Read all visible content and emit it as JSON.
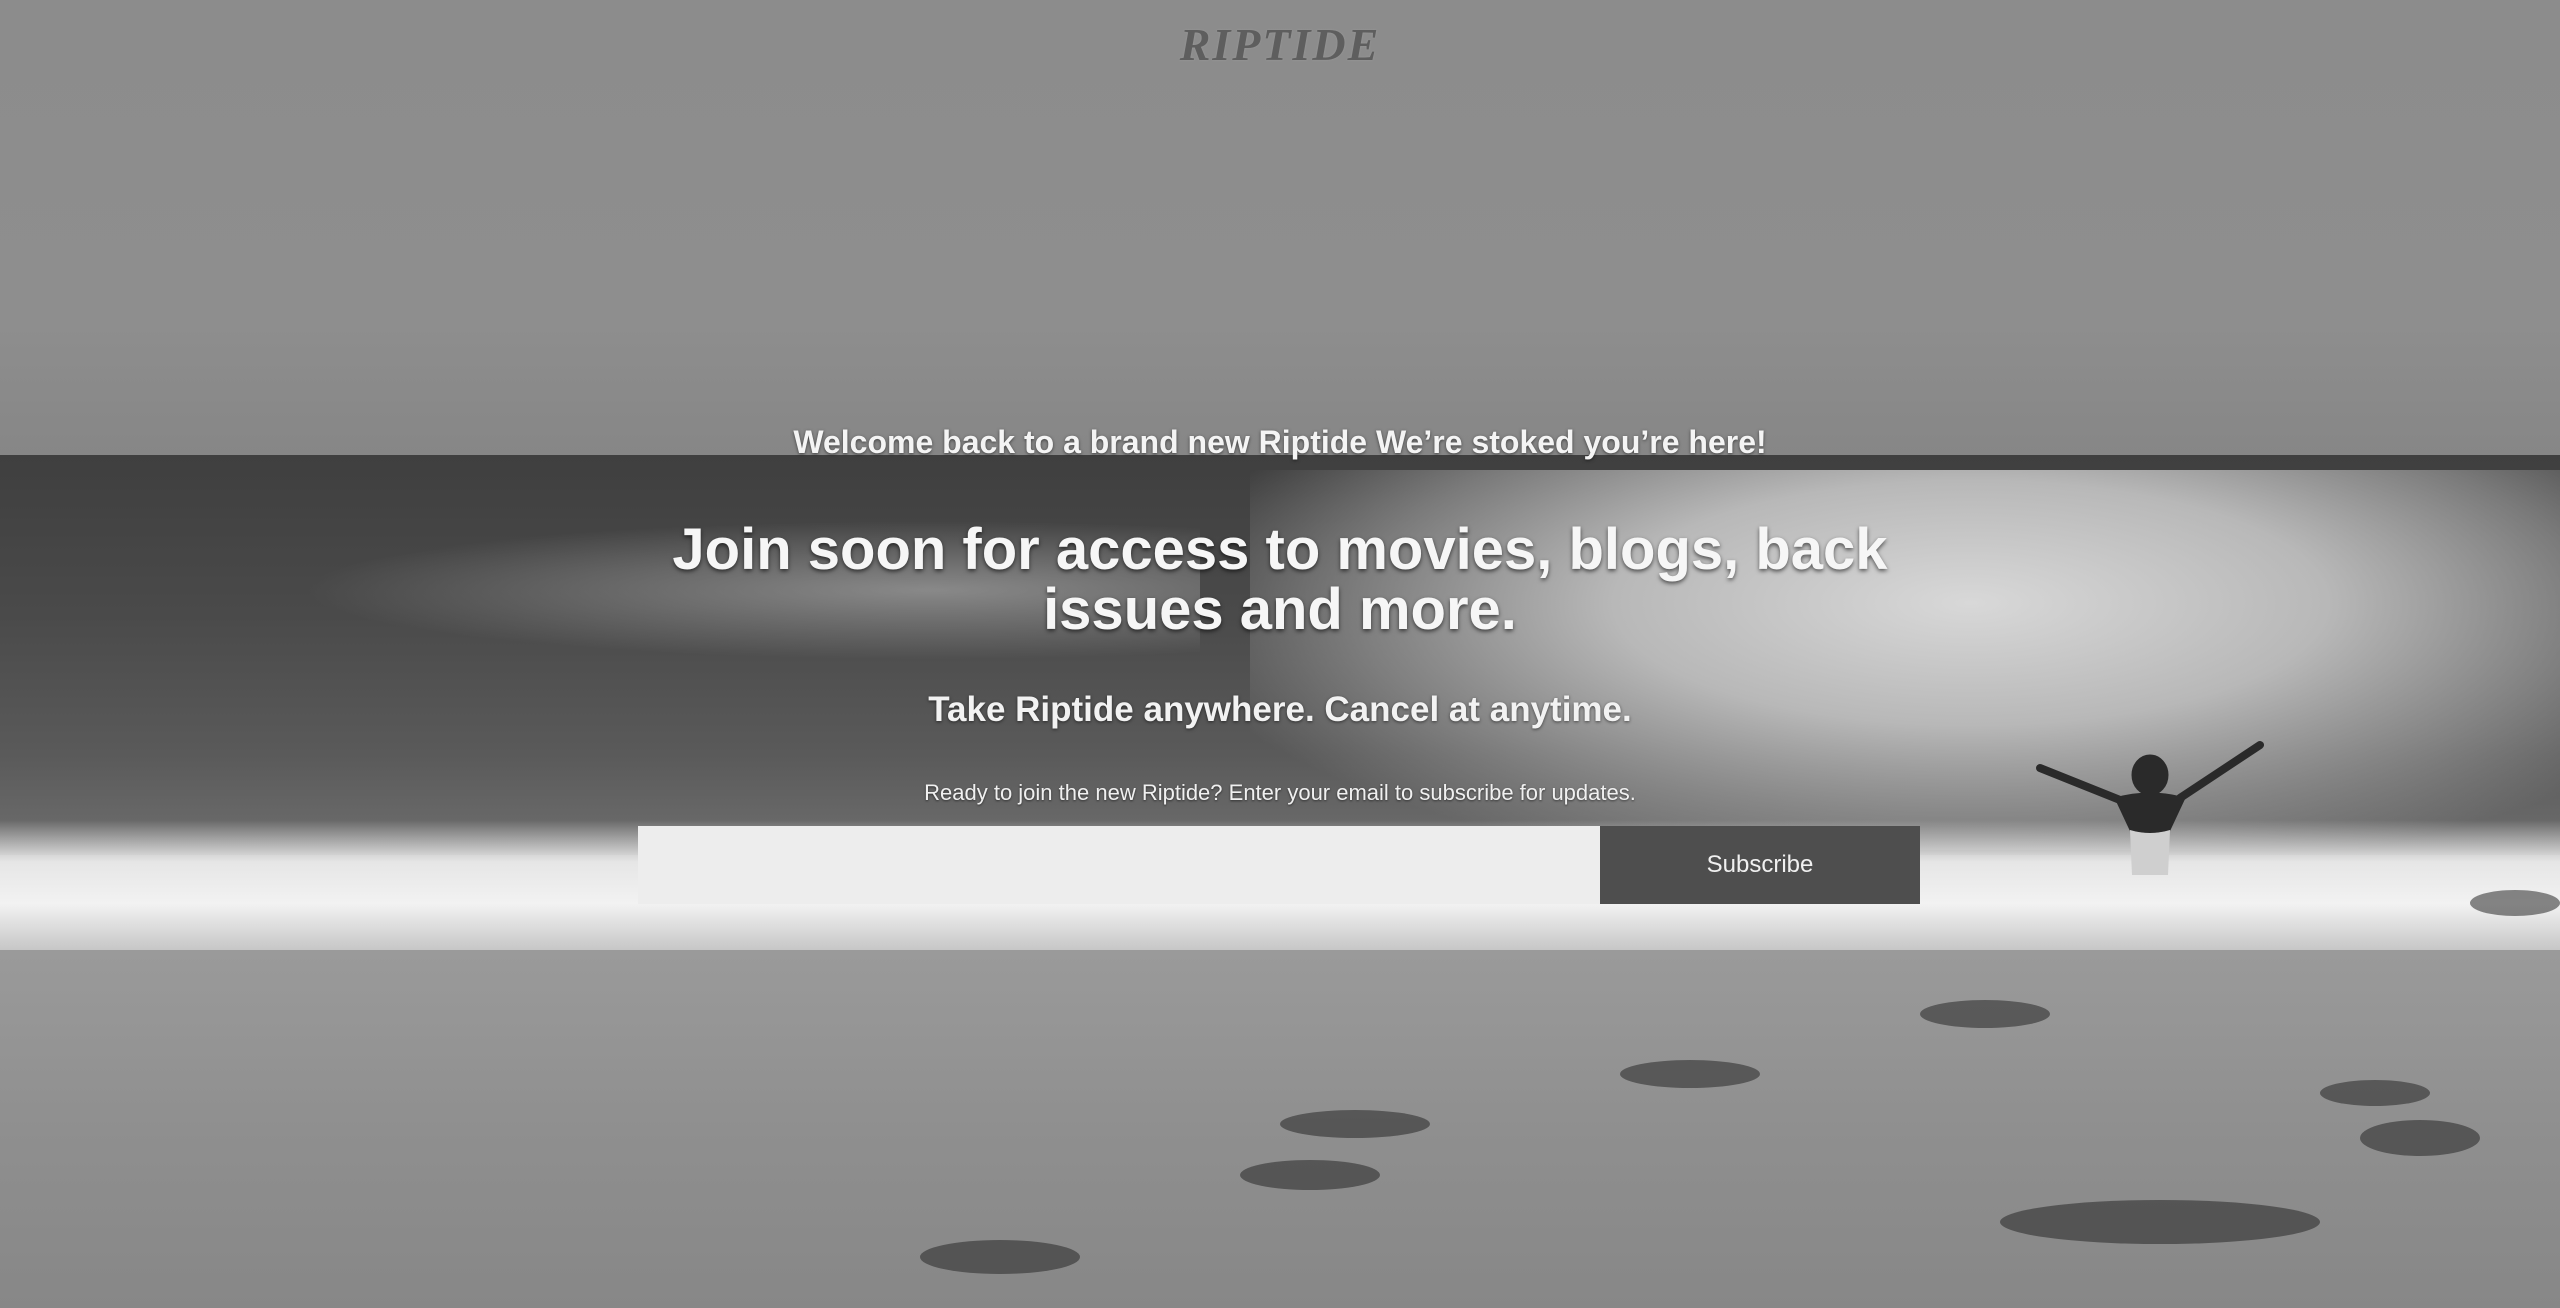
{
  "brand": {
    "logo_text": "RIPTIDE"
  },
  "hero": {
    "welcome": "Welcome back to a brand new Riptide  We’re stoked you’re here!",
    "headline": "Join soon for access to movies, blogs, back issues and more.",
    "tagline": "Take Riptide anywhere. Cancel at anytime.",
    "prompt": "Ready to join the new Riptide? Enter your email to subscribe for updates."
  },
  "subscribe_form": {
    "email_value": "",
    "email_placeholder": "",
    "button_label": "Subscribe"
  },
  "colors": {
    "button_bg": "#4e4e4e",
    "input_bg": "#ededed",
    "text": "#f4f4f4"
  }
}
